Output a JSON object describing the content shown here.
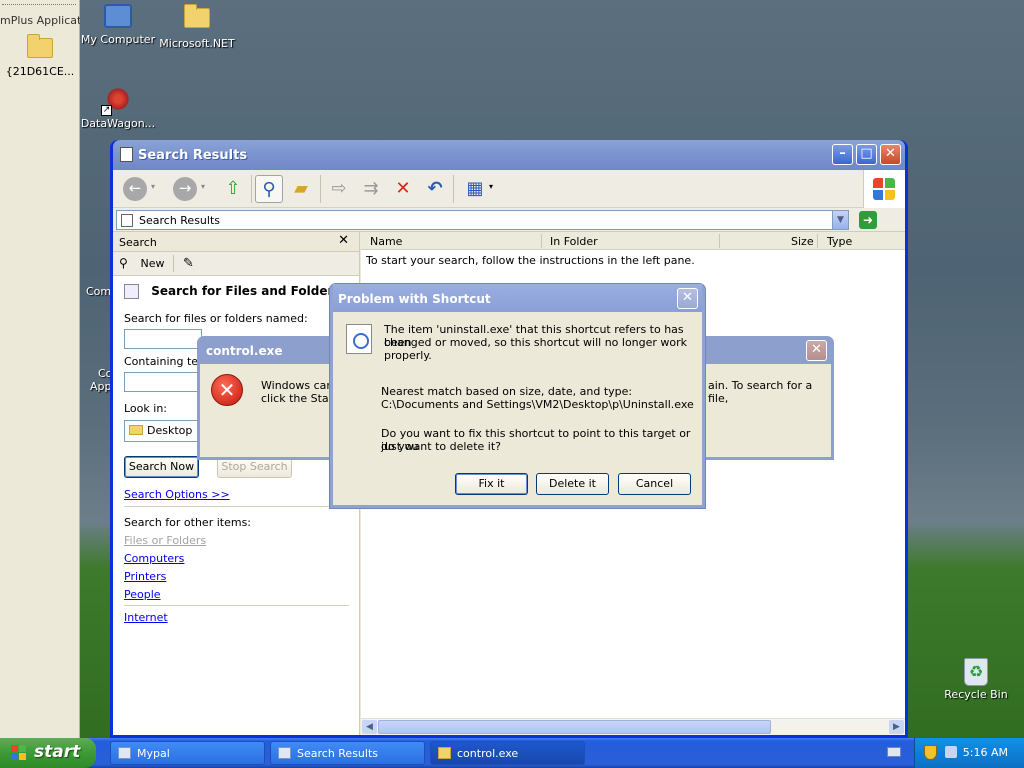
{
  "desktop": {
    "strip_title": "mPlus Applicatio",
    "strip_folder_label": "{21D61CE...",
    "icons": {
      "my_computer": "My Computer",
      "microsoft_net": "Microsoft.NET",
      "datawagon": "DataWagon...",
      "recycle_bin": "Recycle Bin",
      "partial_1": "Comm",
      "partial_2a": "Co",
      "partial_2b": "App"
    }
  },
  "explorer": {
    "title": "Search Results",
    "address": "Search Results",
    "search_pane": {
      "header": "Search",
      "new_label": "New",
      "heading": "Search for Files and Folders",
      "named_label": "Search for files or folders named:",
      "containing_label": "Containing text:",
      "lookin_label": "Look in:",
      "lookin_value": "Desktop",
      "search_now": "Search Now",
      "stop_search": "Stop Search",
      "options_link": "Search Options >>",
      "other_items_label": "Search for other items:",
      "links": [
        "Files or Folders",
        "Computers",
        "Printers",
        "People"
      ],
      "internet": "Internet"
    },
    "columns": [
      "Name",
      "In Folder",
      "Size",
      "Type"
    ],
    "results_message": "To start your search, follow the instructions in the left pane."
  },
  "control_dialog": {
    "title": "control.exe",
    "text_left_1": "Windows cann",
    "text_left_2": "click the Start",
    "text_right": "ain. To search for a file,"
  },
  "shortcut_dialog": {
    "title": "Problem with Shortcut",
    "message_1": "The item 'uninstall.exe' that this shortcut refers to has been",
    "message_2": "changed or moved, so this shortcut will no longer work properly.",
    "match_label": "Nearest match based on size, date, and type:",
    "match_path": "C:\\Documents and Settings\\VM2\\Desktop\\p\\Uninstall.exe",
    "question_1": "Do you want to fix this shortcut to point to this target or do you",
    "question_2": "just want to delete it?",
    "buttons": {
      "fix": "Fix it",
      "delete": "Delete it",
      "cancel": "Cancel"
    }
  },
  "taskbar": {
    "start": "start",
    "tasks": [
      "Mypal",
      "Search Results",
      "control.exe"
    ],
    "clock": "5:16 AM"
  },
  "colors": {
    "xp_blue": "#0831d9",
    "dialog_face": "#ece9d8",
    "start_green": "#3c9a35",
    "link_blue": "#0000ee"
  }
}
